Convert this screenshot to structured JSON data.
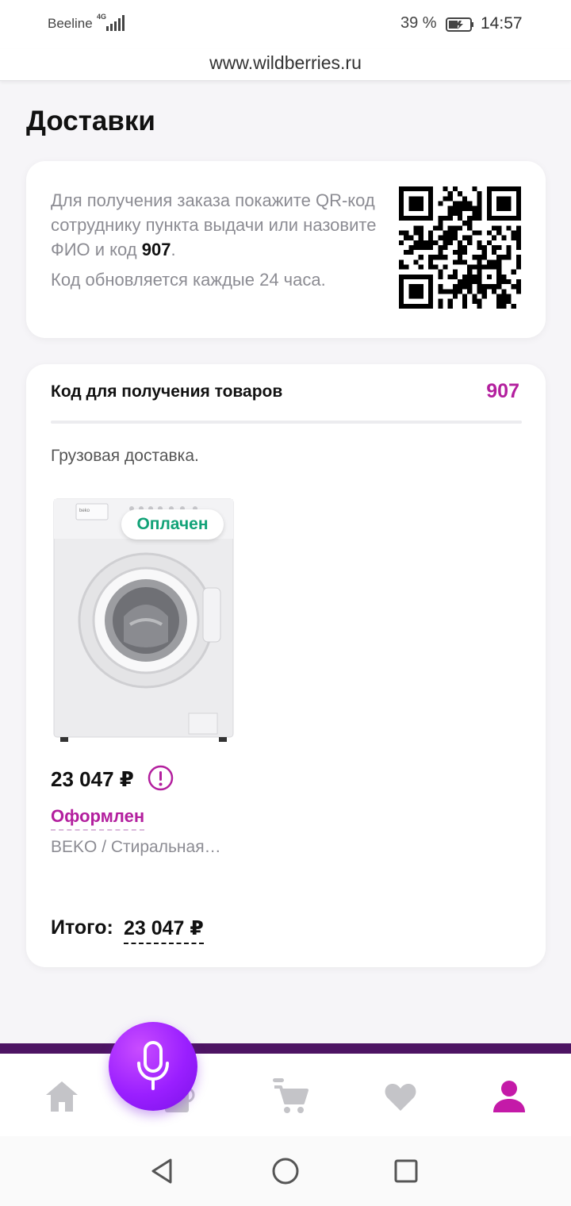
{
  "status_bar": {
    "carrier": "Beeline",
    "network": "4G",
    "battery_percent": "39 %",
    "time": "14:57"
  },
  "browser": {
    "url": "www.wildberries.ru"
  },
  "page": {
    "title": "Доставки"
  },
  "qr_card": {
    "instruction_pre": "Для получения заказа покажите QR-код сотруднику пункта выдачи или назовите ФИО и код ",
    "code": "907",
    "instruction_post": ".",
    "refresh_note": "Код обновляется каждые 24 часа."
  },
  "order": {
    "code_label": "Код для получения товаров",
    "code_value": "907",
    "delivery_type": "Грузовая доставка.",
    "badge": "Оплачен",
    "price": "23 047 ₽",
    "status": "Оформлен",
    "product_name": "BEKO / Стиральная…",
    "total_label": "Итого:",
    "total_value": "23 047 ₽"
  },
  "bottom_nav": {
    "items": [
      {
        "icon": "home-icon",
        "active": false
      },
      {
        "icon": "catalog-icon",
        "active": false
      },
      {
        "icon": "cart-icon",
        "active": false
      },
      {
        "icon": "heart-icon",
        "active": false
      },
      {
        "icon": "profile-icon",
        "active": true
      }
    ],
    "mic": "microphone-icon"
  },
  "colors": {
    "accent": "#b31f9e",
    "paid": "#11a277",
    "nav_bar": "#4d1463",
    "mic": "#9a1fff"
  }
}
